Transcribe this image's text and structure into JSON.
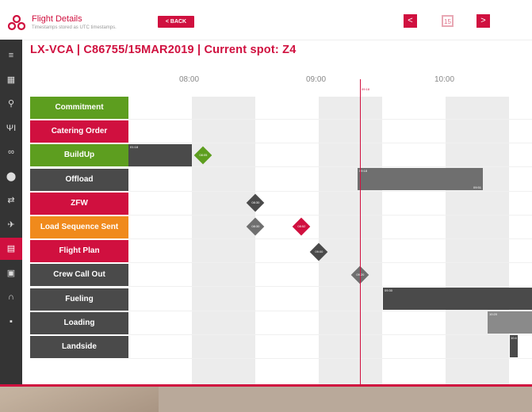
{
  "header": {
    "title": "Flight Details",
    "subtitle": "Timestamps stored as UTC timestamps.",
    "back_label": "< BACK",
    "prev_label": "<",
    "next_label": ">",
    "calendar_label": "15"
  },
  "page_title": "LX-VCA | C86755/15MAR2019 | Current spot: Z4",
  "timeline": {
    "hours": [
      "08:00",
      "09:00",
      "10:00"
    ],
    "now_label": "09:18"
  },
  "sidebar": {
    "icons": [
      "menu-icon",
      "dashboard-icon",
      "search-icon",
      "catering-icon",
      "link-icon",
      "location-pin-icon",
      "transfer-icon",
      "aircraft-icon",
      "calendar-icon",
      "bus-icon",
      "headset-icon",
      "more-icon"
    ]
  },
  "rows": [
    {
      "label": "Commitment",
      "color": "#5d9e1f"
    },
    {
      "label": "Catering Order",
      "color": "#d0103f"
    },
    {
      "label": "BuildUp",
      "color": "#5d9e1f"
    },
    {
      "label": "Offload",
      "color": "#4a4a4a"
    },
    {
      "label": "ZFW",
      "color": "#d0103f"
    },
    {
      "label": "Load Sequence Sent",
      "color": "#f08a1c"
    },
    {
      "label": "Flight Plan",
      "color": "#d0103f"
    },
    {
      "label": "Crew Call Out",
      "color": "#4a4a4a"
    },
    {
      "label": "Fueling",
      "color": "#4a4a4a"
    },
    {
      "label": "Loading",
      "color": "#4a4a4a"
    },
    {
      "label": "Landside",
      "color": "#4a4a4a"
    }
  ],
  "events": {
    "buildup_start": "01:18",
    "buildup_end": "08:05",
    "offload_start": "09:18",
    "offload_end": "09:51",
    "zfw": "08:30",
    "ls1": "08:30",
    "ls2": "08:52",
    "flight_plan": "09:00",
    "crew": "09:20",
    "fueling_start": "09:30",
    "loading_start": "10:20",
    "landside_start": "10:4"
  }
}
